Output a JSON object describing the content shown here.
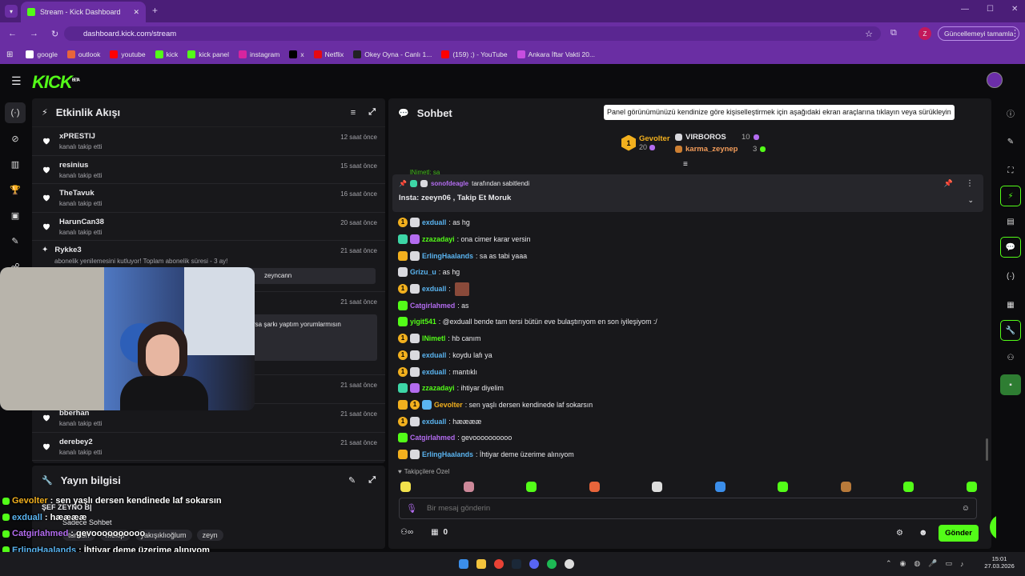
{
  "browser": {
    "tab_title": "Stream - Kick Dashboard",
    "url": "dashboard.kick.com/stream",
    "update_button": "Güncellemeyi tamamla",
    "profile_initial": "Z",
    "bookmarks": [
      "google",
      "outlook",
      "youtube",
      "kick",
      "kick panel",
      "instagram",
      "x",
      "Netflix",
      "Okey Oyna - Canlı 1...",
      "(159) ;) - YouTube",
      "Ankara İftar Vakti 20..."
    ]
  },
  "app": {
    "logo": "KICK",
    "logo_sup": "BETA"
  },
  "activity": {
    "title": "Etkinlik Akışı",
    "events": [
      {
        "name": "xPRESTIJ",
        "action": "kanalı takip etti",
        "time": "12 saat önce"
      },
      {
        "name": "resinius",
        "action": "kanalı takip etti",
        "time": "15 saat önce"
      },
      {
        "name": "TheTavuk",
        "action": "kanalı takip etti",
        "time": "16 saat önce"
      },
      {
        "name": "HarunCan38",
        "action": "kanalı takip etti",
        "time": "20 saat önce"
      }
    ],
    "sub_event": {
      "name": "Rykke3",
      "text": "abonelik yenilemesini kutluyor! Toplam abonelik süresi - 3 ay!",
      "time": "21 saat önce",
      "quote": "zeyncann"
    },
    "event6": {
      "time": "21 saat önce",
      "quote": "rsa şarkı yaptım yorumlarmısın"
    },
    "event7": {
      "time": "21 saat önce"
    },
    "events_bottom": [
      {
        "name": "bberhan",
        "action": "kanalı takip etti",
        "time": "21 saat önce"
      },
      {
        "name": "derebey2",
        "action": "kanalı takip etti",
        "time": "21 saat önce"
      }
    ]
  },
  "stream_info": {
    "title": "Yayın bilgisi",
    "overlay_subtitle": "ŞEF ZEYNO B|",
    "overlay_mode": "Sadece Sohbet",
    "tags": [
      "turkish",
      "mekip",
      "yakışıklıoğlum",
      "zeyn"
    ]
  },
  "overlay_chat": [
    {
      "user": "Gevolter",
      "text": ": sen yaşlı dersen kendinede laf sokarsın",
      "color": "#f2b01e"
    },
    {
      "user": "exduall",
      "text": ": hææææ",
      "color": "#5ab4f0"
    },
    {
      "user": "Catgirlahmed",
      "text": ": gevoooooooooo",
      "color": "#b36cf0"
    },
    {
      "user": "ErlingHaalands",
      "text": ": İhtiyar deme üzerime alınıyom",
      "color": "#5ab4f0"
    }
  ],
  "chat": {
    "title": "Sohbet",
    "tooltip": "Panel görünümünüzü kendinize göre kişiselleştirmek için aşağıdaki ekran araçlarına tıklayın veya sürükleyin",
    "leaderboard": {
      "top": {
        "name": "Gevolter",
        "value": "20",
        "rank": "1"
      },
      "second": {
        "name": "VIRBOROS",
        "value": "10"
      },
      "third": {
        "name": "karma_zeynep",
        "value": "3"
      }
    },
    "partial_line": "lNimetl: sa",
    "pinned": {
      "by_user": "sonofdeagle",
      "by_text": "tarafından sabitlendi",
      "message": "Insta: zeeyn06 , Takip Et Moruk"
    },
    "messages": [
      {
        "user": "exduall",
        "text": ": as hg",
        "color": "#5ab4f0",
        "badges": [
          "gold",
          "white"
        ]
      },
      {
        "user": "zzazadayi",
        "text": ": ona cimer karar versin",
        "color": "#53fc18",
        "badges": [
          "teal",
          "purple"
        ]
      },
      {
        "user": "ErlingHaalands",
        "text": ": sa as tabi yaaa",
        "color": "#5ab4f0",
        "badges": [
          "crown",
          "white"
        ]
      },
      {
        "user": "Grizu_u",
        "text": ": as hg",
        "color": "#5ab4f0",
        "badges": [
          "white"
        ]
      },
      {
        "user": "exduall",
        "text": ":",
        "color": "#5ab4f0",
        "badges": [
          "gold",
          "white"
        ]
      },
      {
        "user": "Catgirlahmed",
        "text": ": as",
        "color": "#b36cf0",
        "badges": [
          "green"
        ]
      },
      {
        "user": "yigit541",
        "text": ": @exduall bende tam tersi bütün eve bulaştırıyom en son iyileşiyom :/",
        "color": "#53fc18",
        "badges": [
          "green"
        ]
      },
      {
        "user": "lNimetl",
        "text": ": hb canım",
        "color": "#53fc18",
        "badges": [
          "gold",
          "white"
        ]
      },
      {
        "user": "exduall",
        "text": ": koydu lafı ya",
        "color": "#5ab4f0",
        "badges": [
          "gold",
          "white"
        ]
      },
      {
        "user": "exduall",
        "text": ": mantıklı",
        "color": "#5ab4f0",
        "badges": [
          "gold",
          "white"
        ]
      },
      {
        "user": "zzazadayi",
        "text": ": ihtiyar diyelim",
        "color": "#53fc18",
        "badges": [
          "teal",
          "purple"
        ]
      },
      {
        "user": "Gevolter",
        "text": ": sen yaşlı dersen kendinede laf sokarsın",
        "color": "#f2b01e",
        "badges": [
          "crown",
          "gold",
          "blue"
        ]
      },
      {
        "user": "exduall",
        "text": ": hææææ",
        "color": "#5ab4f0",
        "badges": [
          "gold",
          "white"
        ]
      },
      {
        "user": "Catgirlahmed",
        "text": ": gevoooooooooo",
        "color": "#b36cf0",
        "badges": [
          "green"
        ]
      },
      {
        "user": "ErlingHaalands",
        "text": ": İhtiyar deme üzerime alınıyom",
        "color": "#5ab4f0",
        "badges": [
          "crown",
          "white"
        ]
      }
    ],
    "followers_only": "Takipçilere Özel",
    "input_placeholder": "Bir mesaj gönderin",
    "points": "0",
    "send_button": "Gönder"
  },
  "taskbar": {
    "time": "15:01",
    "date": "27.03.2026"
  },
  "colors": {
    "accent": "#53fc18",
    "browser": "#6a2ea3",
    "panel": "#18181b"
  }
}
